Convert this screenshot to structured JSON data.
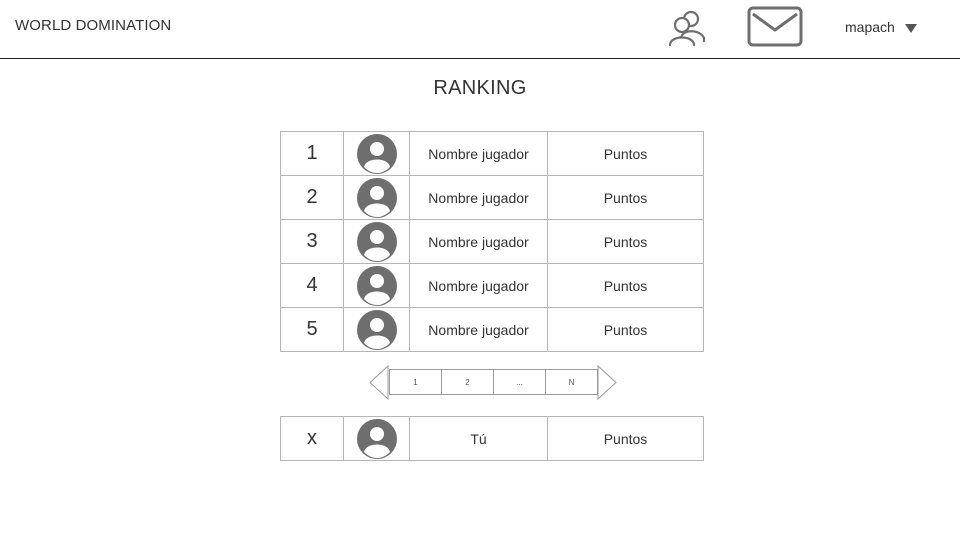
{
  "header": {
    "brand": "WORLD DOMINATION",
    "friends_icon": "friends-icon",
    "mail_icon": "mail-icon",
    "username": "mapach"
  },
  "page": {
    "title": "RANKING"
  },
  "ranking": [
    {
      "position": "1",
      "name": "Nombre jugador",
      "points": "Puntos"
    },
    {
      "position": "2",
      "name": "Nombre jugador",
      "points": "Puntos"
    },
    {
      "position": "3",
      "name": "Nombre jugador",
      "points": "Puntos"
    },
    {
      "position": "4",
      "name": "Nombre jugador",
      "points": "Puntos"
    },
    {
      "position": "5",
      "name": "Nombre jugador",
      "points": "Puntos"
    }
  ],
  "pagination": {
    "pages": [
      "1",
      "2",
      "...",
      "N"
    ]
  },
  "current_user": {
    "position": "x",
    "name": "Tú",
    "points": "Puntos"
  },
  "colors": {
    "icon_gray": "#6e6e6e",
    "border": "#b5b5b5",
    "header_line": "#222222"
  }
}
